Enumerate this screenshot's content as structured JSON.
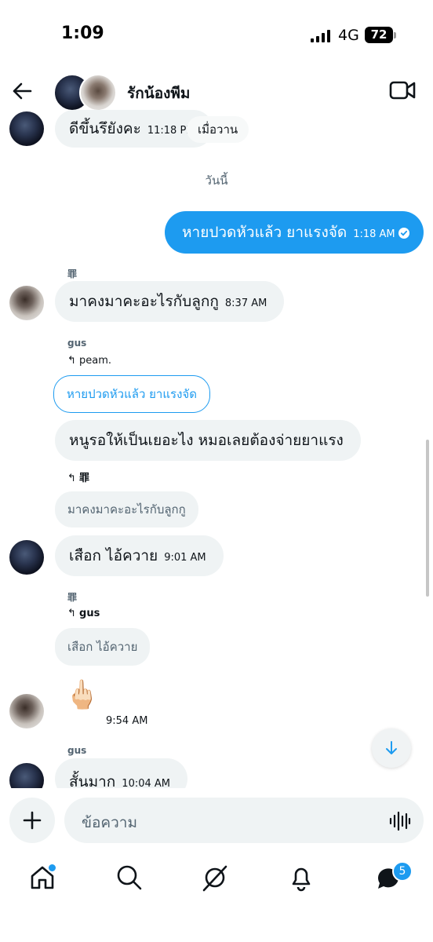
{
  "status_bar": {
    "time": "1:09",
    "network": "4G",
    "battery": "72"
  },
  "header": {
    "title": "รักน้องพีม"
  },
  "day_separator": "วันนี้",
  "messages": {
    "m0": {
      "text": "ดีขึ้นรึยังคะ",
      "time": "11:18 PM",
      "reaction_label": "เมื่อวาน"
    },
    "m1": {
      "text": "หายปวดหัวแล้ว ยาแรงจัด",
      "time": "1:18 AM"
    },
    "m2": {
      "sender": "罪",
      "text": "มาคงมาคะอะไรกับลูกกู",
      "time": "8:37 AM"
    },
    "m3": {
      "sender": "gus",
      "reply_to": "peam.",
      "quoted": "หายปวดหัวแล้ว ยาแรงจัด",
      "text": "หนูรอให้เป็นเยอะไง หมอเลยต้องจ่ายยาแรง"
    },
    "m4": {
      "reply_to": "罪",
      "quoted": "มาคงมาคะอะไรกับลูกกู",
      "text": "เสือก ไอ้ควาย",
      "time": "9:01 AM"
    },
    "m5": {
      "sender": "罪",
      "reply_to": "gus",
      "quoted": "เสือก ไอ้ควาย"
    },
    "m6": {
      "emoji": "🖕🏻",
      "time": "9:54 AM"
    },
    "m7": {
      "sender": "gus",
      "text": "สั้นมาก",
      "time": "10:04 AM"
    }
  },
  "composer": {
    "placeholder": "ข้อความ"
  },
  "nav": {
    "messages_badge": "5"
  }
}
